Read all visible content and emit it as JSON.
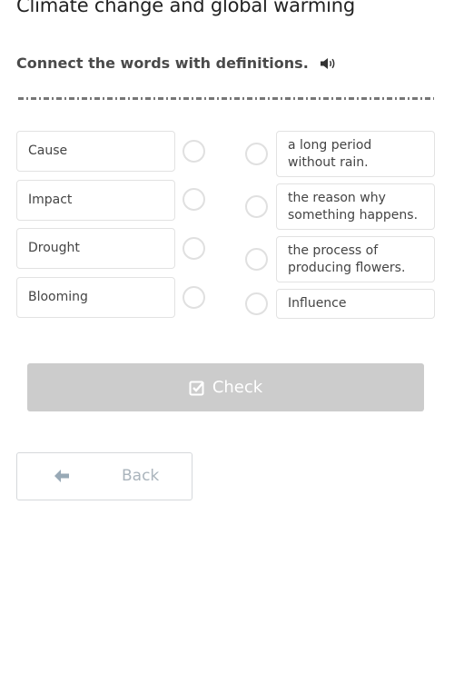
{
  "page": {
    "title": "Climate change and global warming",
    "instruction": "Connect the words with definitions."
  },
  "exercise": {
    "words": [
      {
        "label": "Cause"
      },
      {
        "label": "Impact"
      },
      {
        "label": "Drought"
      },
      {
        "label": "Blooming"
      }
    ],
    "definitions": [
      {
        "label": "a long period without rain."
      },
      {
        "label": "the reason why something happens."
      },
      {
        "label": "the process of producing flowers."
      },
      {
        "label": "Influence"
      }
    ]
  },
  "actions": {
    "check_label": "Check",
    "back_label": "Back"
  },
  "icons": {
    "speaker": "speaker-icon",
    "check": "checkbox-check-icon",
    "back": "arrow-left-icon"
  },
  "colors": {
    "check_button_bg": "#cccccc",
    "back_text": "#aab4bc",
    "box_border": "#e2e2e2"
  }
}
